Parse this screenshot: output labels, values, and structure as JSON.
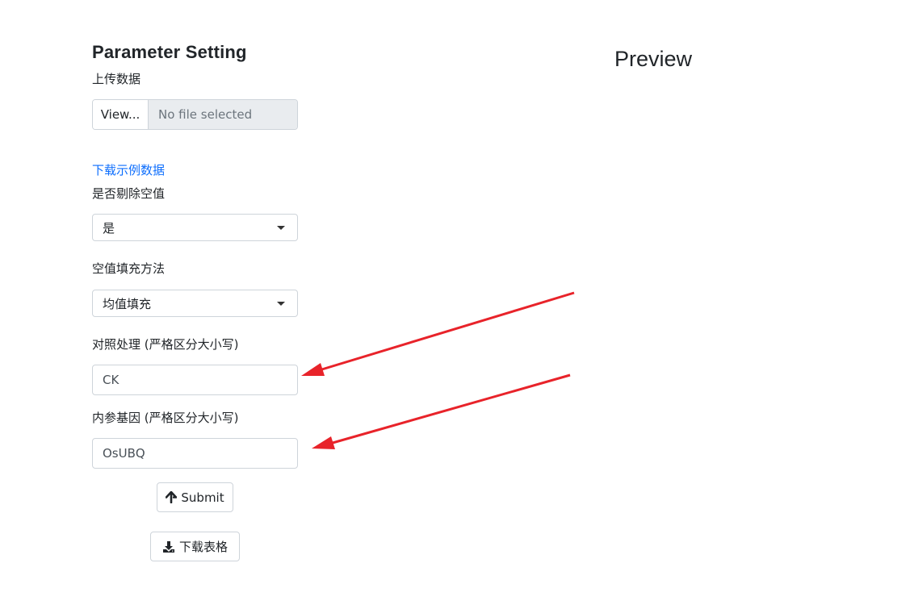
{
  "sidebar": {
    "title": "Parameter Setting",
    "upload": {
      "label": "上传数据",
      "button_label": "View...",
      "placeholder": "No file selected"
    },
    "example_link": "下载示例数据",
    "remove_na": {
      "label": "是否剔除空值",
      "selected": "是"
    },
    "fill_method": {
      "label": "空值填充方法",
      "selected": "均值填充"
    },
    "control": {
      "label": "对照处理 (严格区分大小写)",
      "value": "CK"
    },
    "ref_gene": {
      "label": "内参基因 (严格区分大小写)",
      "value": "OsUBQ"
    },
    "submit_label": "Submit",
    "download_label": "下载表格"
  },
  "main": {
    "title": "Preview"
  },
  "annotations": {
    "arrow_color": "#e8232a"
  }
}
